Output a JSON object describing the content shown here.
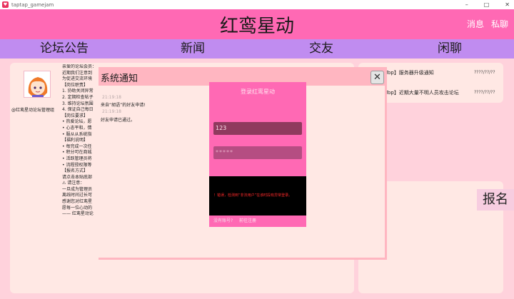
{
  "window": {
    "title": "taptap_gamejam",
    "app_icon": "♥",
    "minimize": "–",
    "maximize": "□",
    "close": "✕"
  },
  "header": {
    "title": "红鸾星动",
    "messages": "消息",
    "private_chat": "私聊"
  },
  "nav": [
    {
      "label": "论坛公告"
    },
    {
      "label": "新闻"
    },
    {
      "label": "交友"
    },
    {
      "label": "闲聊"
    }
  ],
  "post": {
    "author": "@红鸾星动论坛管理组",
    "lines": [
      "亲爱的论坛会员：",
      "近期我们注意到",
      "为促进交流环境",
      "【岗位职责】",
      "1. 协助关闭异常",
      "2. 定期检查帖子",
      "3. 维持论坛氛围",
      "4. 保证自己每日",
      "【岗位要求】",
      "• 热爱论坛，愿",
      "• 心态平和，情",
      "• 服从从系统指",
      "【福利说明】",
      "• 每完成一次任",
      "• 积分可在商城",
      "• 活跃管理员将",
      "• 流程授权限等",
      "【报名方式】",
      "请点击本贴底部",
      "⚠ 请注意：",
      "一旦成为管理员",
      "离线时间过长可",
      "感谢您对红鸾星",
      "愿每一位心动的",
      "—— 红鸾星动论"
    ]
  },
  "news": [
    {
      "title": "Top】服务器升级通知",
      "date": "????/??/??"
    },
    {
      "title": "Top】近期大量不明人员攻击论坛",
      "date": "????/??/??"
    }
  ],
  "signup_label": "报名",
  "system_dialog": {
    "title": "系统通知",
    "close_label": "✕",
    "notices": [
      {
        "time": "21:19:18",
        "text": "来自“胡语”的好友申请!"
      },
      {
        "time": "21:19:18",
        "text": "好友申请已通过。"
      }
    ]
  },
  "login": {
    "title": "登录红鸾星动",
    "username_value": "123",
    "password_value": "*****",
    "message": "！错误，检测到“非法用户”在该时段有异常登录。",
    "no_account": "没有账号?",
    "register": "前往注册"
  },
  "colors": {
    "header": "#ff69b4",
    "nav": "#c08cf0",
    "panel": "#ffe8e4",
    "background": "#ffd2dc",
    "dialog_border": "#ffb6c1",
    "error_text": "#ff2a2a"
  }
}
